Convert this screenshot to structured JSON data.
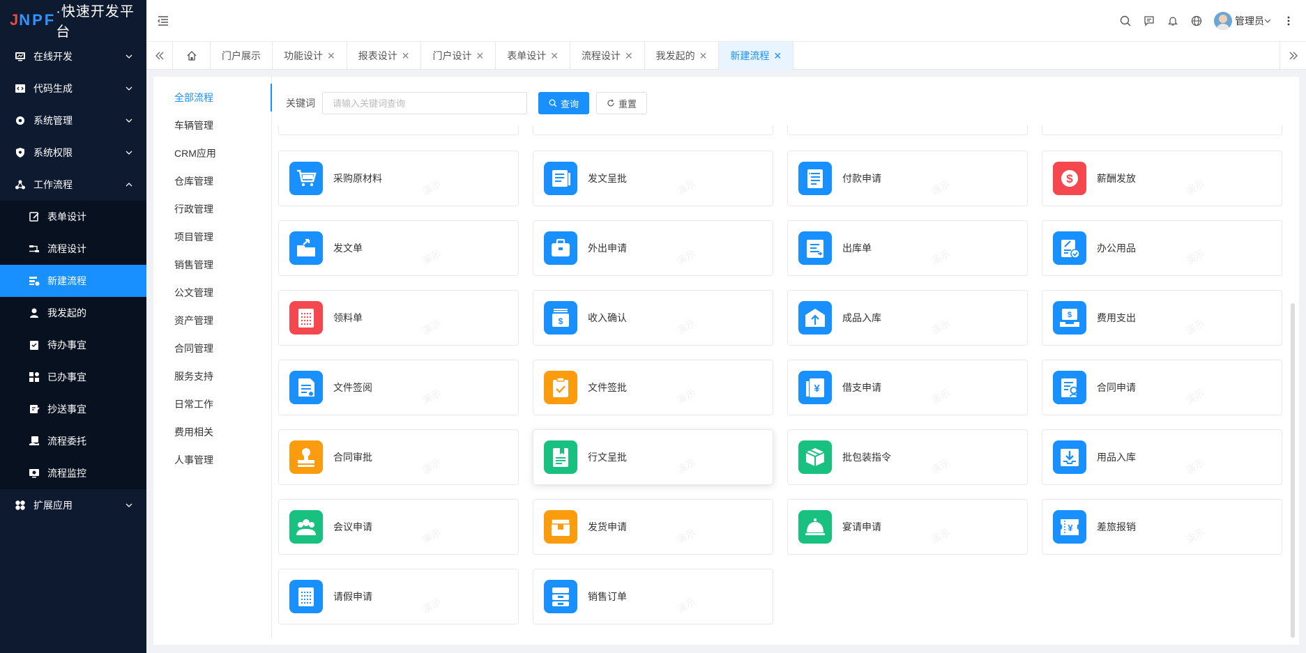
{
  "app": {
    "logo_j": "J",
    "logo_npf": "NPF",
    "logo_cn": "·快速开发平台"
  },
  "sidebar": {
    "items": [
      {
        "label": "在线开发",
        "icon": "monitor-icon",
        "expanded": false
      },
      {
        "label": "代码生成",
        "icon": "code-icon",
        "expanded": false
      },
      {
        "label": "系统管理",
        "icon": "gear-icon",
        "expanded": false
      },
      {
        "label": "系统权限",
        "icon": "shield-icon",
        "expanded": false
      },
      {
        "label": "工作流程",
        "icon": "flow-icon",
        "expanded": true
      },
      {
        "label": "扩展应用",
        "icon": "apps-icon",
        "expanded": false
      }
    ],
    "workflow_sub": [
      {
        "label": "表单设计",
        "icon": "form-edit-icon"
      },
      {
        "label": "流程设计",
        "icon": "flow-design-icon"
      },
      {
        "label": "新建流程",
        "icon": "new-flow-icon",
        "active": true
      },
      {
        "label": "我发起的",
        "icon": "user-icon"
      },
      {
        "label": "待办事宜",
        "icon": "todo-icon"
      },
      {
        "label": "已办事宜",
        "icon": "done-icon"
      },
      {
        "label": "抄送事宜",
        "icon": "cc-icon"
      },
      {
        "label": "流程委托",
        "icon": "delegate-icon"
      },
      {
        "label": "流程监控",
        "icon": "monitor-eye-icon"
      }
    ]
  },
  "header": {
    "user_name": "管理员"
  },
  "tabs": [
    {
      "label": "门户展示",
      "closable": false
    },
    {
      "label": "功能设计",
      "closable": true
    },
    {
      "label": "报表设计",
      "closable": true
    },
    {
      "label": "门户设计",
      "closable": true
    },
    {
      "label": "表单设计",
      "closable": true
    },
    {
      "label": "流程设计",
      "closable": true
    },
    {
      "label": "我发起的",
      "closable": true
    },
    {
      "label": "新建流程",
      "closable": true,
      "active": true
    }
  ],
  "categories": [
    "全部流程",
    "车辆管理",
    "CRM应用",
    "仓库管理",
    "行政管理",
    "项目管理",
    "销售管理",
    "公文管理",
    "资产管理",
    "合同管理",
    "服务支持",
    "日常工作",
    "费用相关",
    "人事管理"
  ],
  "search": {
    "label": "关键词",
    "placeholder": "请输入关键词查询",
    "query_button": "查询",
    "reset_button": "重置"
  },
  "watermark": "演示",
  "flows": [
    {
      "label": "采购原材料",
      "color": "#1890ff",
      "icon": "cart-icon"
    },
    {
      "label": "发文呈批",
      "color": "#1890ff",
      "icon": "document-list-icon"
    },
    {
      "label": "付款申请",
      "color": "#1890ff",
      "icon": "payment-list-icon"
    },
    {
      "label": "薪酬发放",
      "color": "#f5484e",
      "icon": "dollar-icon"
    },
    {
      "label": "发文单",
      "color": "#1890ff",
      "icon": "folder-send-icon"
    },
    {
      "label": "外出申请",
      "color": "#1890ff",
      "icon": "briefcase-icon"
    },
    {
      "label": "出库单",
      "color": "#1890ff",
      "icon": "outbound-icon"
    },
    {
      "label": "办公用品",
      "color": "#1890ff",
      "icon": "office-supplies-icon"
    },
    {
      "label": "领料单",
      "color": "#f5484e",
      "icon": "material-list-icon"
    },
    {
      "label": "收入确认",
      "color": "#1890ff",
      "icon": "income-icon"
    },
    {
      "label": "成品入库",
      "color": "#1890ff",
      "icon": "warehouse-in-icon"
    },
    {
      "label": "费用支出",
      "color": "#1890ff",
      "icon": "expense-icon"
    },
    {
      "label": "文件签阅",
      "color": "#1890ff",
      "icon": "file-read-icon"
    },
    {
      "label": "文件签批",
      "color": "#fa9c0e",
      "icon": "clipboard-check-icon"
    },
    {
      "label": "借支申请",
      "color": "#1890ff",
      "icon": "yen-book-icon"
    },
    {
      "label": "合同申请",
      "color": "#1890ff",
      "icon": "contract-icon"
    },
    {
      "label": "合同审批",
      "color": "#fa9c0e",
      "icon": "stamp-icon"
    },
    {
      "label": "行文呈批",
      "color": "#18c17f",
      "icon": "bookmark-doc-icon",
      "highlight": true
    },
    {
      "label": "批包装指令",
      "color": "#18c17f",
      "icon": "package-icon"
    },
    {
      "label": "用品入库",
      "color": "#1890ff",
      "icon": "inbox-download-icon"
    },
    {
      "label": "会议申请",
      "color": "#18c17f",
      "icon": "meeting-icon"
    },
    {
      "label": "发货申请",
      "color": "#fa9c0e",
      "icon": "shipping-box-icon"
    },
    {
      "label": "宴请申请",
      "color": "#18c17f",
      "icon": "dining-bell-icon"
    },
    {
      "label": "差旅报销",
      "color": "#1890ff",
      "icon": "travel-ticket-icon"
    },
    {
      "label": "请假申请",
      "color": "#1890ff",
      "icon": "leave-list-icon"
    },
    {
      "label": "销售订单",
      "color": "#1890ff",
      "icon": "sales-order-icon"
    }
  ]
}
